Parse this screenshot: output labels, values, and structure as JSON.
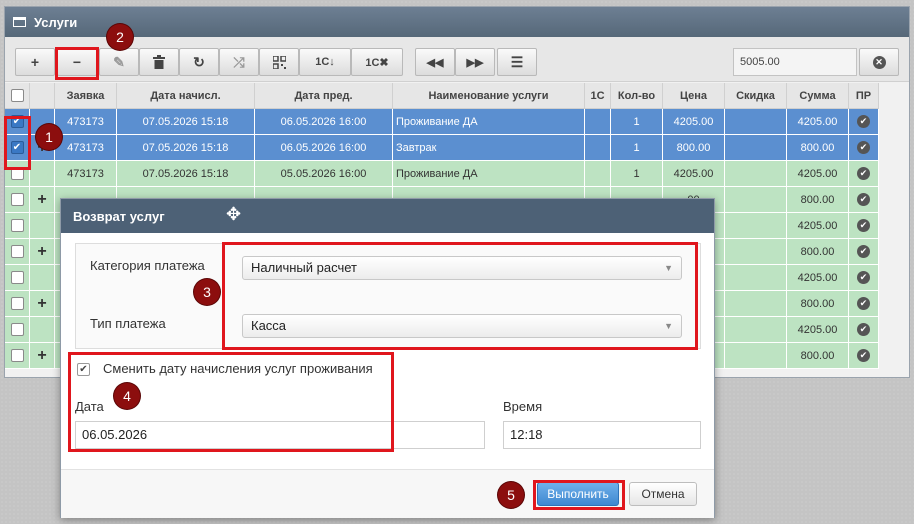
{
  "panel": {
    "title": "Услуги"
  },
  "toolbar": {
    "add_label": "+",
    "remove_label": "−",
    "edit_icon": "pencil-icon",
    "delete_icon": "trash-icon",
    "refresh_icon": "refresh-icon",
    "shuffle_icon": "shuffle-icon",
    "qr_icon": "qr-icon",
    "export_1c_label": "1С↓",
    "cancel_1c_label": "1С✖",
    "prev_label": "◀◀",
    "next_label": "▶▶",
    "settings_icon": "sliders-icon",
    "amount_value": "5005.00",
    "clear_icon": "close-circle-icon"
  },
  "grid": {
    "columns": [
      "",
      "",
      "Заявка",
      "Дата начисл.",
      "Дата пред.",
      "Наименование услуги",
      "1С",
      "Кол-во",
      "Цена",
      "Скидка",
      "Сумма",
      "ПР"
    ],
    "rows": [
      {
        "checked": true,
        "plus": false,
        "order": "473173",
        "date_charge": "07.05.2026 15:18",
        "date_prov": "06.05.2026 16:00",
        "service": "Проживание ДА",
        "c1": "",
        "qty": "1",
        "price": "4205.00",
        "discount": "",
        "sum": "4205.00",
        "style": "sel"
      },
      {
        "checked": true,
        "plus": true,
        "order": "473173",
        "date_charge": "07.05.2026 15:18",
        "date_prov": "06.05.2026 16:00",
        "service": "Завтрак",
        "c1": "",
        "qty": "1",
        "price": "800.00",
        "discount": "",
        "sum": "800.00",
        "style": "sel"
      },
      {
        "checked": false,
        "plus": false,
        "order": "473173",
        "date_charge": "07.05.2026 15:18",
        "date_prov": "05.05.2026 16:00",
        "service": "Проживание ДА",
        "c1": "",
        "qty": "1",
        "price": "4205.00",
        "discount": "",
        "sum": "4205.00",
        "style": "green"
      },
      {
        "checked": false,
        "plus": true,
        "order": "",
        "date_charge": "",
        "date_prov": "",
        "service": "",
        "c1": "",
        "qty": "",
        "price": "00",
        "discount": "",
        "sum": "800.00",
        "style": "green"
      },
      {
        "checked": false,
        "plus": false,
        "order": "",
        "date_charge": "",
        "date_prov": "",
        "service": "",
        "c1": "",
        "qty": "",
        "price": "00",
        "discount": "",
        "sum": "4205.00",
        "style": "green"
      },
      {
        "checked": false,
        "plus": true,
        "order": "",
        "date_charge": "",
        "date_prov": "",
        "service": "",
        "c1": "",
        "qty": "",
        "price": "00",
        "discount": "",
        "sum": "800.00",
        "style": "green"
      },
      {
        "checked": false,
        "plus": false,
        "order": "",
        "date_charge": "",
        "date_prov": "",
        "service": "",
        "c1": "",
        "qty": "",
        "price": "00",
        "discount": "",
        "sum": "4205.00",
        "style": "green"
      },
      {
        "checked": false,
        "plus": true,
        "order": "",
        "date_charge": "",
        "date_prov": "",
        "service": "",
        "c1": "",
        "qty": "",
        "price": "00",
        "discount": "",
        "sum": "800.00",
        "style": "green"
      },
      {
        "checked": false,
        "plus": false,
        "order": "",
        "date_charge": "",
        "date_prov": "",
        "service": "",
        "c1": "",
        "qty": "",
        "price": "00",
        "discount": "",
        "sum": "4205.00",
        "style": "green"
      },
      {
        "checked": false,
        "plus": true,
        "order": "",
        "date_charge": "",
        "date_prov": "",
        "service": "",
        "c1": "",
        "qty": "",
        "price": "00",
        "discount": "",
        "sum": "800.00",
        "style": "green"
      }
    ]
  },
  "dialog": {
    "title": "Возврат услуг",
    "payment_category_label": "Категория платежа",
    "payment_category_value": "Наличный расчет",
    "payment_type_label": "Тип платежа",
    "payment_type_value": "Касса",
    "change_date_checked": true,
    "change_date_label": "Сменить дату начисления услуг проживания",
    "date_label": "Дата",
    "date_value": "06.05.2026",
    "time_label": "Время",
    "time_value": "12:18",
    "execute_label": "Выполнить",
    "cancel_label": "Отмена"
  },
  "annotations": {
    "badge1": "1",
    "badge2": "2",
    "badge3": "3",
    "badge4": "4",
    "badge5": "5"
  },
  "colors": {
    "highlight": "#e0161d",
    "badge": "#8c0e0e",
    "selected_row": "#5b8fd0",
    "green_row": "#bde3c2",
    "header": "#566879"
  }
}
